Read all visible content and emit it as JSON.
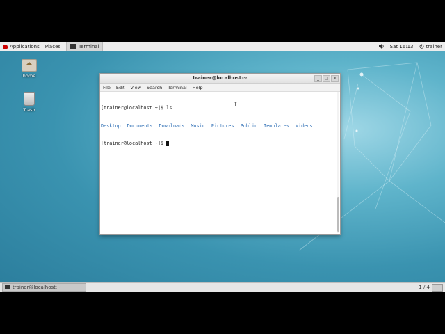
{
  "topbar": {
    "applications": "Applications",
    "places": "Places",
    "task": "Terminal",
    "clock": "Sat 16:13",
    "user": "trainer"
  },
  "desktop": {
    "home_label": "home",
    "trash_label": "Trash"
  },
  "window": {
    "title": "trainer@localhost:~",
    "menu": [
      "File",
      "Edit",
      "View",
      "Search",
      "Terminal",
      "Help"
    ]
  },
  "terminal": {
    "line1": "[trainer@localhost ~]$ ls",
    "dirs": [
      "Desktop",
      "Documents",
      "Downloads",
      "Music",
      "Pictures",
      "Public",
      "Templates",
      "Videos"
    ],
    "prompt": "[trainer@localhost ~]$ "
  },
  "bottombar": {
    "task_label": "trainer@localhost:~",
    "workspace": "1 / 4"
  },
  "colors": {
    "desktop_bg": "#3a93b0",
    "dir_text": "#2f6fb5"
  }
}
